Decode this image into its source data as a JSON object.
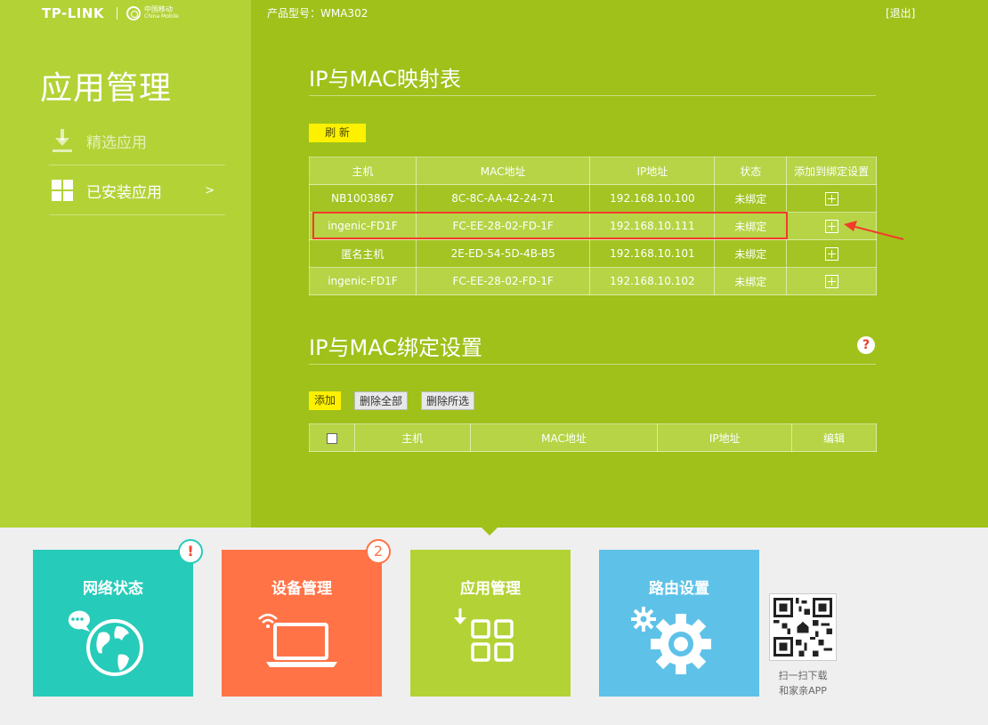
{
  "brand": {
    "name": "TP-LINK",
    "partner_cn": "中国移动",
    "partner_en": "China Mobile"
  },
  "header": {
    "model_label": "产品型号：WMA302",
    "logout": "[退出]"
  },
  "sidebar": {
    "title": "应用管理",
    "items": [
      {
        "label": "精选应用",
        "icon": "download-icon"
      },
      {
        "label": "已安装应用",
        "icon": "grid-icon",
        "arrow": ">"
      }
    ]
  },
  "mapping": {
    "title": "IP与MAC映射表",
    "refresh": "刷 新",
    "columns": [
      "主机",
      "MAC地址",
      "IP地址",
      "状态",
      "添加到绑定设置"
    ],
    "rows": [
      {
        "host": "NB1003867",
        "mac": "8C-8C-AA-42-24-71",
        "ip": "192.168.10.100",
        "status": "未绑定"
      },
      {
        "host": "ingenic-FD1F",
        "mac": "FC-EE-28-02-FD-1F",
        "ip": "192.168.10.111",
        "status": "未绑定"
      },
      {
        "host": "匿名主机",
        "mac": "2E-ED-54-5D-4B-B5",
        "ip": "192.168.10.101",
        "status": "未绑定"
      },
      {
        "host": "ingenic-FD1F",
        "mac": "FC-EE-28-02-FD-1F",
        "ip": "192.168.10.102",
        "status": "未绑定"
      }
    ]
  },
  "binding": {
    "title": "IP与MAC绑定设置",
    "add": "添加",
    "delete_all": "删除全部",
    "delete_selected": "删除所选",
    "columns": [
      "主机",
      "MAC地址",
      "IP地址",
      "编辑"
    ],
    "help": "?"
  },
  "tiles": [
    {
      "label": "网络状态",
      "badge": "!"
    },
    {
      "label": "设备管理",
      "badge": "2"
    },
    {
      "label": "应用管理"
    },
    {
      "label": "路由设置"
    }
  ],
  "qr": {
    "caption_line1": "扫一扫下载",
    "caption_line2": "和家亲APP"
  },
  "colors": {
    "main_green": "#9fc11a",
    "sidebar_green": "#b3d236",
    "tile_network": "#27cbb9",
    "tile_devices": "#ff7347",
    "tile_apps": "#b3d236",
    "tile_router": "#5ec2e8",
    "highlight_red": "#f33b2b",
    "button_yellow": "#fef100"
  }
}
